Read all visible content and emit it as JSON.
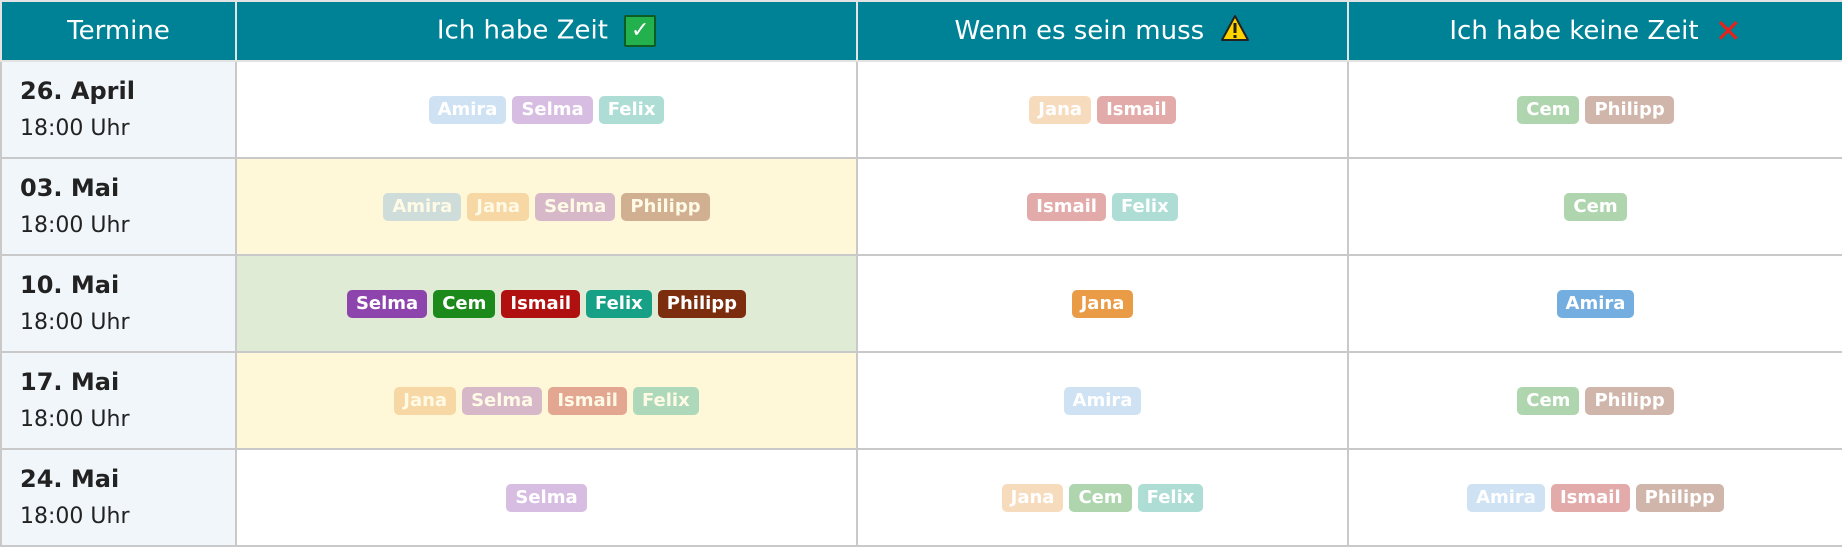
{
  "colors": {
    "header_bg": "#008296",
    "date_bg": "#f0f6fa",
    "row_yellow": "#fff8d8",
    "row_green": "#dfebd5",
    "people": {
      "Amira": "#74aee0",
      "Selma": "#8e44ad",
      "Felix": "#16a085",
      "Jana": "#e99b45",
      "Ismail": "#b01010",
      "Cem": "#1b8a1b",
      "Philipp": "#7b2d0e"
    }
  },
  "headers": {
    "termine": "Termine",
    "yes": "Ich habe Zeit",
    "maybe": "Wenn es sein muss",
    "no": "Ich habe keine Zeit"
  },
  "icons": {
    "yes": "check-mark-icon",
    "maybe": "warning-icon",
    "no": "cross-mark-icon"
  },
  "rows": [
    {
      "date": "26. April",
      "time": "18:00 Uhr",
      "highlight": "none",
      "faded": true,
      "yes": [
        "Amira",
        "Selma",
        "Felix"
      ],
      "maybe": [
        "Jana",
        "Ismail"
      ],
      "no": [
        "Cem",
        "Philipp"
      ]
    },
    {
      "date": "03. Mai",
      "time": "18:00 Uhr",
      "highlight": "yellow",
      "faded": true,
      "yes": [
        "Amira",
        "Jana",
        "Selma",
        "Philipp"
      ],
      "maybe": [
        "Ismail",
        "Felix"
      ],
      "no": [
        "Cem"
      ]
    },
    {
      "date": "10. Mai",
      "time": "18:00 Uhr",
      "highlight": "green",
      "faded": false,
      "yes": [
        "Selma",
        "Cem",
        "Ismail",
        "Felix",
        "Philipp"
      ],
      "maybe": [
        "Jana"
      ],
      "no": [
        "Amira"
      ]
    },
    {
      "date": "17. Mai",
      "time": "18:00 Uhr",
      "highlight": "yellow",
      "faded": true,
      "yes": [
        "Jana",
        "Selma",
        "Ismail",
        "Felix"
      ],
      "maybe": [
        "Amira"
      ],
      "no": [
        "Cem",
        "Philipp"
      ]
    },
    {
      "date": "24. Mai",
      "time": "18:00 Uhr",
      "highlight": "none",
      "faded": true,
      "yes": [
        "Selma"
      ],
      "maybe": [
        "Jana",
        "Cem",
        "Felix"
      ],
      "no": [
        "Amira",
        "Ismail",
        "Philipp"
      ]
    }
  ]
}
